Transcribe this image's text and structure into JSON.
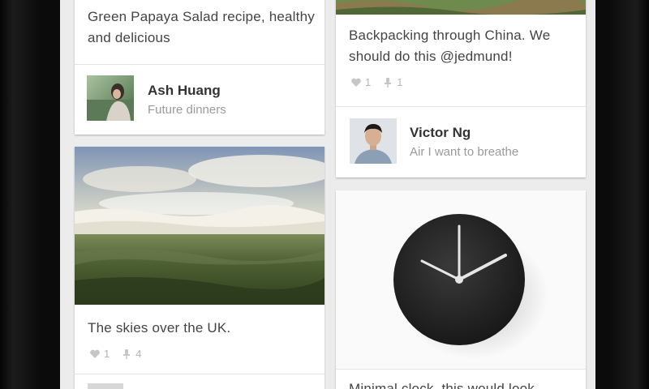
{
  "cards": [
    {
      "caption": "Green Papaya Salad recipe, healthy and delicious",
      "user": {
        "name": "Ash Huang",
        "board": "Future dinners"
      }
    },
    {
      "caption": "Backpacking through China. We should do this @jedmund!",
      "likes": "1",
      "repins": "1",
      "user": {
        "name": "Victor Ng",
        "board": "Air I want to breathe"
      }
    },
    {
      "caption": "The skies over the UK.",
      "likes": "1",
      "repins": "4"
    },
    {
      "caption": "Minimal clock, this would look"
    }
  ],
  "icons": {
    "like": "heart-icon",
    "repin": "pin-icon"
  },
  "colors": {
    "background": "#ececec",
    "card": "#ffffff",
    "text": "#444444",
    "muted": "#9a9a9a"
  }
}
